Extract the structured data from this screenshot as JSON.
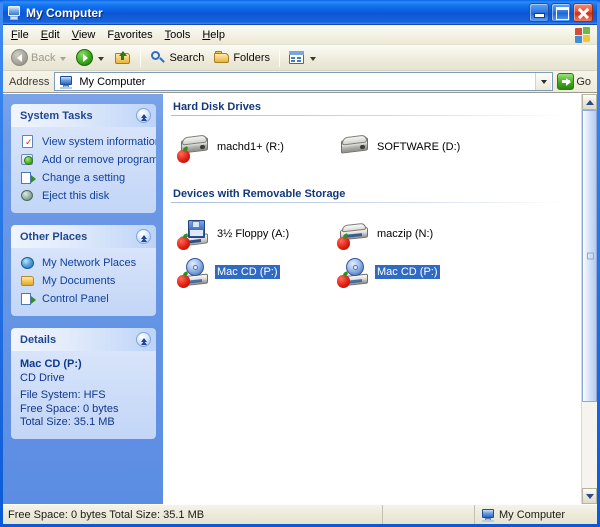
{
  "window": {
    "title": "My Computer",
    "title_icon": "my-computer-icon",
    "buttons": {
      "minimize": "Minimize",
      "maximize": "Maximize",
      "close": "Close"
    }
  },
  "menubar": {
    "items": [
      {
        "label": "File",
        "accel": "F"
      },
      {
        "label": "Edit",
        "accel": "E"
      },
      {
        "label": "View",
        "accel": "V"
      },
      {
        "label": "Favorites",
        "accel": "a"
      },
      {
        "label": "Tools",
        "accel": "T"
      },
      {
        "label": "Help",
        "accel": "H"
      }
    ],
    "brand_icon": "windows-flag-icon"
  },
  "toolbar": {
    "back_label": "Back",
    "back_enabled": false,
    "forward_label": "Forward",
    "up_label": "Up",
    "search_label": "Search",
    "folders_label": "Folders",
    "views_label": "Views"
  },
  "addressbar": {
    "label": "Address",
    "value": "My Computer",
    "icon": "my-computer-icon",
    "go_label": "Go"
  },
  "sidebar": {
    "panels": [
      {
        "title": "System Tasks",
        "collapse_label": "Collapse",
        "items": [
          {
            "label": "View system information",
            "icon": "system-info-icon"
          },
          {
            "label": "Add or remove programs",
            "icon": "add-remove-programs-icon"
          },
          {
            "label": "Change a setting",
            "icon": "control-panel-icon"
          },
          {
            "label": "Eject this disk",
            "icon": "eject-disk-icon"
          }
        ]
      },
      {
        "title": "Other Places",
        "collapse_label": "Collapse",
        "items": [
          {
            "label": "My Network Places",
            "icon": "network-places-icon"
          },
          {
            "label": "My Documents",
            "icon": "my-documents-icon"
          },
          {
            "label": "Control Panel",
            "icon": "control-panel-icon"
          }
        ]
      }
    ],
    "details": {
      "title": "Details",
      "collapse_label": "Collapse",
      "name": "Mac CD (P:)",
      "type": "CD Drive",
      "file_system": "File System: HFS",
      "free_space": "Free Space: 0 bytes",
      "total_size": "Total Size: 35.1 MB"
    }
  },
  "content": {
    "sections": [
      {
        "title": "Hard Disk Drives",
        "drives": [
          {
            "label": "machd1+ (R:)",
            "icon": "hard-disk-icon",
            "badge": "apple-badge",
            "selected": false
          },
          {
            "label": "SOFTWARE (D:)",
            "icon": "hard-disk-icon",
            "badge": "none",
            "selected": false
          }
        ]
      },
      {
        "title": "Devices with Removable Storage",
        "drives": [
          {
            "label": "3½ Floppy (A:)",
            "icon": "floppy-drive-icon",
            "badge": "apple-badge",
            "selected": false
          },
          {
            "label": "maczip (N:)",
            "icon": "removable-drive-icon",
            "badge": "apple-badge",
            "selected": false
          },
          {
            "label": "Mac CD (P:)",
            "icon": "cd-drive-icon",
            "badge": "apple-badge",
            "selected": true
          },
          {
            "label": "Mac CD (P:)",
            "icon": "cd-drive-icon",
            "badge": "apple-badge",
            "selected": true
          }
        ]
      }
    ]
  },
  "statusbar": {
    "info": "Free Space: 0 bytes Total Size: 35.1 MB",
    "zone": "My Computer",
    "zone_icon": "my-computer-icon"
  },
  "colors": {
    "title_blue": "#0a5ad6",
    "sidebar_blue": "#6a97e3",
    "selection_blue": "#316ac5",
    "section_header": "#13377c",
    "link_blue": "#11409c"
  }
}
